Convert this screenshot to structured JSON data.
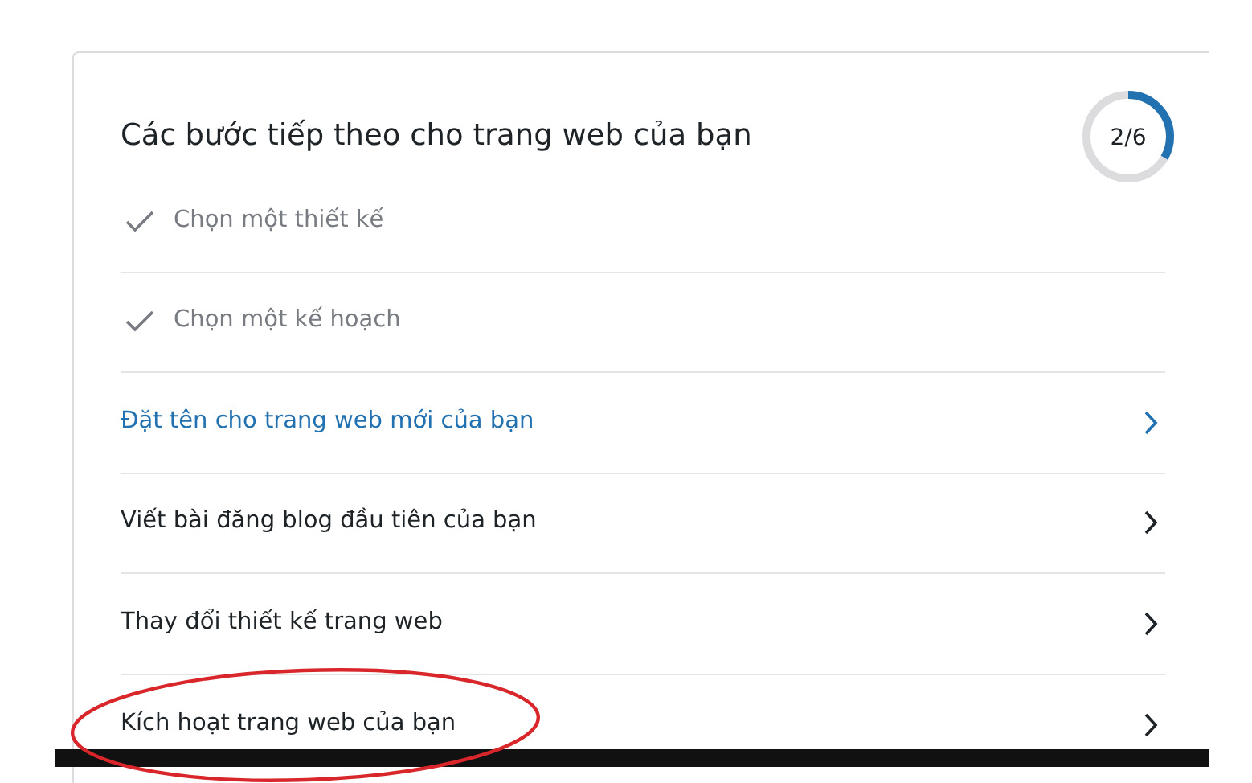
{
  "card": {
    "title": "Các bước tiếp theo cho trang web của bạn",
    "progress": {
      "text": "2/6"
    },
    "steps": [
      {
        "label": "Chọn một thiết kế",
        "kind": "done"
      },
      {
        "label": "Chọn một kế hoạch",
        "kind": "done"
      },
      {
        "label": "Đặt tên cho trang web mới của bạn",
        "kind": "next"
      },
      {
        "label": "Viết bài đăng blog đầu tiên của bạn",
        "kind": "todo"
      },
      {
        "label": "Thay đổi thiết kế trang web",
        "kind": "todo"
      },
      {
        "label": "Kích hoạt trang web của bạn",
        "kind": "todo"
      }
    ]
  }
}
